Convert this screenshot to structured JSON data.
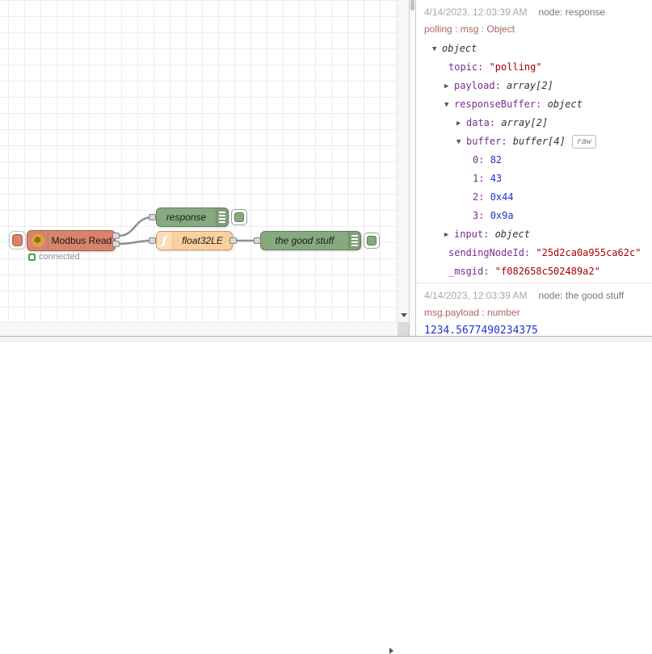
{
  "canvas": {
    "nodes": {
      "modbus": {
        "label": "Modbus Read",
        "status_label": "connected",
        "fill": "#d8846c",
        "border": "#a85c48",
        "status_color": "#4c9f4c",
        "icon": "modbus-flower-icon",
        "icon_glyph": "✽"
      },
      "response": {
        "label": "response",
        "fill": "#87a980",
        "border": "#61805b",
        "icon": "debug-lines-icon"
      },
      "float32": {
        "label": "float32LE",
        "fill": "#fbd09e",
        "border": "#c89b62",
        "icon": "function-f-icon",
        "icon_glyph": "ƒ"
      },
      "goodstuff": {
        "label": "the good stuff",
        "fill": "#87a980",
        "border": "#61805b",
        "icon": "debug-lines-icon"
      }
    }
  },
  "debug_panel": {
    "colors": {
      "key": "#792e90",
      "string": "#aa0000",
      "number": "#2033d0",
      "path": "#aa6666",
      "timestamp": "#aaaaaa",
      "nodename": "#777777"
    },
    "messages": [
      {
        "timestamp": "4/14/2023, 12:03:39 AM",
        "node": "node: response",
        "path": "polling : msg : Object",
        "tree": [
          {
            "indent": 0,
            "arrow": "▼",
            "value": "object",
            "vtype": "type"
          },
          {
            "indent": 1,
            "key": "topic",
            "value": "\"polling\"",
            "vtype": "string"
          },
          {
            "indent": 1,
            "arrow": "▶",
            "key": "payload",
            "value": "array[2]",
            "vtype": "type"
          },
          {
            "indent": 1,
            "arrow": "▼",
            "key": "responseBuffer",
            "value": "object",
            "vtype": "type"
          },
          {
            "indent": 2,
            "arrow": "▶",
            "key": "data",
            "value": "array[2]",
            "vtype": "type"
          },
          {
            "indent": 2,
            "arrow": "▼",
            "key": "buffer",
            "value": "buffer[4]",
            "vtype": "type",
            "raw": "raw"
          },
          {
            "indent": 3,
            "key": "0",
            "value": "82",
            "vtype": "number"
          },
          {
            "indent": 3,
            "key": "1",
            "value": "43",
            "vtype": "number"
          },
          {
            "indent": 3,
            "key": "2",
            "value": "0x44",
            "vtype": "number"
          },
          {
            "indent": 3,
            "key": "3",
            "value": "0x9a",
            "vtype": "number"
          },
          {
            "indent": 1,
            "arrow": "▶",
            "key": "input",
            "value": "object",
            "vtype": "type"
          },
          {
            "indent": 1,
            "key": "sendingNodeId",
            "value": "\"25d2ca0a955ca62c\"",
            "vtype": "string"
          },
          {
            "indent": 1,
            "key": "_msgid",
            "value": "\"f082658c502489a2\"",
            "vtype": "string"
          }
        ]
      },
      {
        "timestamp": "4/14/2023, 12:03:39 AM",
        "node": "node: the good stuff",
        "path": "msg.payload : number",
        "value": "1234.5677490234375"
      }
    ]
  }
}
